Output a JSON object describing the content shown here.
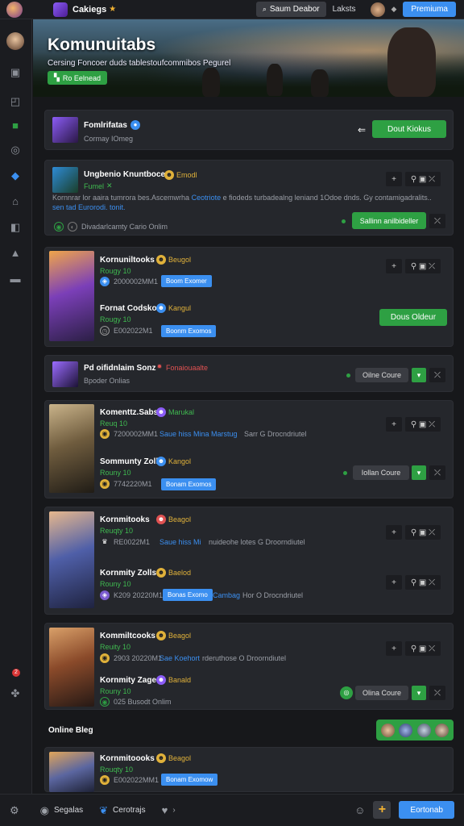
{
  "topbar": {
    "workspace_name": "Cakiegs",
    "search_label": "Saum Deabor",
    "link_label": "Laksts",
    "premium_label": "Premiuma"
  },
  "hero": {
    "title": "Komunuitabs",
    "subtitle": "Cersing Foncoer duds tablestoufcommibos Pegurel",
    "button_label": "Ro Eelnead"
  },
  "community_card": {
    "name": "Fomlrifatas",
    "meta": "Cormay IOmeg",
    "join_label": "Dout Kiokus"
  },
  "post": {
    "title": "Ungbenio Knuntboces",
    "badge": "Emodl",
    "meta": "Fumel",
    "body_a": "Kornnrar lor aaira tumrora bes.Ascemwrha ",
    "body_link": "Ceotriote",
    "body_b": " e fiodeds turbadealng leniand 1Odoe dnds. Gy contamigadralits..",
    "body_line2_a": "sen ",
    "body_line2_b": "tad Eurorodi. tonit.",
    "footer": "Divadarlcamty Cario Onlim",
    "action_label": "Sallinn anilbideller"
  },
  "events": [
    {
      "name": "Kornuniltooks",
      "badge": "Beugol",
      "meta": "Rougy 10",
      "id": "2000002MM1",
      "tag": "Boom Exomer"
    },
    {
      "name": "Fornat Codsko",
      "badge": "Kangul",
      "meta": "Rougy 10",
      "id": "E002022M1",
      "tag": "Boonm Exomos",
      "action_label": "Dous Oldeur"
    }
  ],
  "channel": {
    "name": "Pd oifidnlaim Sonz",
    "badge": "Fonaiouaalte",
    "meta": "Bpoder Onlias",
    "status_label": "Oilne Coure"
  },
  "group2": [
    {
      "name": "Komenttz.Sabs",
      "badge": "Marukal",
      "meta": "Reuq 10",
      "id": "7200002MM1",
      "link": "Saue hiss Mina Marstug",
      "rest": "Sarr G Drocndriutel"
    },
    {
      "name": "Sommunty Zolls",
      "badge": "Kangol",
      "meta": "Rouny 10",
      "id": "7742220M1",
      "tag": "Bonam Exomos",
      "status_label": "Iollan Coure"
    }
  ],
  "group3": [
    {
      "name": "Kornmitooks",
      "badge": "Beagol",
      "meta": "Reuqty 10",
      "id": "RE0022M1",
      "link": "Saue hiss Mi",
      "rest": "nuideohe lotes G Droorndiutel"
    },
    {
      "name": "Kornmity Zolls",
      "badge": "Baelod",
      "meta": "Rouny 10",
      "id": "K209 20220M1",
      "tag": "Bonas Exomo",
      "link": "Cambag",
      "rest": "Hor O Drocndriutel"
    }
  ],
  "group4": [
    {
      "name": "Kommiltcooks",
      "badge": "Beagol",
      "meta": "Reuity 10",
      "id": "2903 20220M1",
      "link": "Sae Koehort",
      "rest": "rderuthose O Droorndiutel"
    },
    {
      "name": "Kornmity Zage",
      "badge": "Banald",
      "meta": "Rouny 10",
      "id": "025 Busodt Onlim",
      "status_label": "Olina Coure"
    }
  ],
  "online": {
    "label": "Online Bleg"
  },
  "group5": {
    "name": "Kornmitoooks",
    "badge": "Beagol",
    "meta": "Rouqty 10",
    "id": "E002022MM1",
    "tag": "Bonam Exomow"
  },
  "bottombar": {
    "item1": "Segalas",
    "item2": "Cerotrajs",
    "join_label": "Eortonab"
  },
  "colors": {
    "accent_green": "#2ea043",
    "accent_blue": "#3b8ff0",
    "badge_gold": "#e0b13a",
    "badge_red": "#e05252"
  }
}
